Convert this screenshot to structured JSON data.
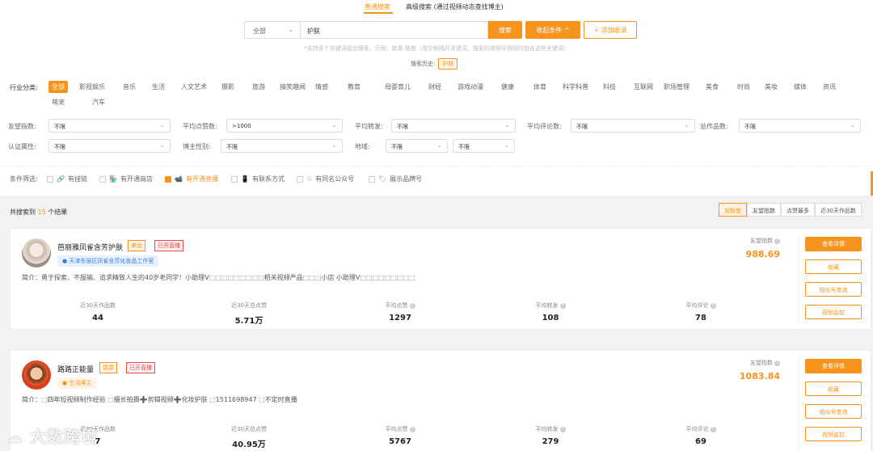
{
  "tabs": {
    "normal": "普通搜索",
    "advanced": "高级搜索 (通过视频动态查找博主)"
  },
  "search": {
    "scope": "全部",
    "query": "护肤",
    "search_btn": "搜索",
    "cond_btn": "收起条件",
    "fav_btn": "添加收录",
    "hint": "*支持多个关键词组合搜索，示例：故事 歌曲（用空格隔开关键词，搜索的视频中将同时包含这些关键词）",
    "history_label": "搜索历史:",
    "history_item": "护肤"
  },
  "industry": {
    "label": "行业分类:",
    "items": [
      "全部",
      "影视娱乐",
      "音乐",
      "生活",
      "人文艺术",
      "摄影",
      "旅游",
      "搞笑趣闻",
      "情感",
      "教育",
      "母婴育儿",
      "财经",
      "游戏动漫",
      "健康",
      "体育",
      "科学科普",
      "科技",
      "互联网",
      "职场管理",
      "美食",
      "时尚",
      "美妆",
      "媒体",
      "资讯",
      "萌宠",
      "汽车"
    ]
  },
  "filters": {
    "r1": [
      {
        "label": "友望指数:",
        "value": "不限"
      },
      {
        "label": "平均点赞数:",
        "value": ">1000"
      },
      {
        "label": "平均转发:",
        "value": "不限"
      },
      {
        "label": "平均评论数:",
        "value": "不限"
      },
      {
        "label": "总作品数:",
        "value": "不限"
      }
    ],
    "r2": [
      {
        "label": "认证属性:",
        "value": "不限"
      },
      {
        "label": "博主性别:",
        "value": "不限"
      },
      {
        "label": "地域:",
        "value": "不限",
        "value2": "不限"
      }
    ]
  },
  "conditions": {
    "label": "条件筛选:",
    "items": [
      "有挂链",
      "有开通商店",
      "有开通直播",
      "有联系方式",
      "有同名公众号",
      "展示品牌号"
    ]
  },
  "results": {
    "prefix": "共搜索到",
    "count": "15",
    "suffix": "个结果"
  },
  "sorts": [
    "友粉度",
    "友望指数",
    "点赞最多",
    "近30天作品数"
  ],
  "cards": [
    {
      "name": "芭丽雅凤雀含芳护肤",
      "tag": "美妆",
      "live": "已开直播",
      "badge": "天津东丽区凤雀含芳化妆品工作室",
      "intro": "简介：勇于探索、不服输、追求精致人生的40岁老同学！小助理V⬚⬚⬚⬚⬚⬚⬚⬚⬚相关视频产品⬚⬚⬚小店 小助理V⬚⬚⬚⬚⬚⬚⬚⬚⬚",
      "stats": [
        {
          "l": "近30天作品数",
          "v": "44"
        },
        {
          "l": "近30天总点赞",
          "v": "5.71万"
        },
        {
          "l": "平均点赞",
          "v": "1297"
        },
        {
          "l": "平均转发",
          "v": "108"
        },
        {
          "l": "平均评论",
          "v": "78"
        }
      ],
      "score_label": "友望指数",
      "score": "988.69",
      "buttons": [
        "查看详情",
        "收藏",
        "相似号查询",
        "视频监控"
      ]
    },
    {
      "name": "路路正能量",
      "tag": "情感",
      "live": "已开直播",
      "badge": "生活博主",
      "intro": "简介：⬚四年短视频制作经验 ⬚擅长拍摄➕剪辑视频➕化妆护肤 ⬚1511698947 ⬚不定时直播",
      "stats": [
        {
          "l": "近30天作品数",
          "v": "7"
        },
        {
          "l": "近30天总点赞",
          "v": "40.95万"
        },
        {
          "l": "平均点赞",
          "v": "5767"
        },
        {
          "l": "平均转发",
          "v": "279"
        },
        {
          "l": "平均评论",
          "v": "69"
        }
      ],
      "score_label": "友望指数",
      "score": "1083.84",
      "buttons": [
        "查看详情",
        "收藏",
        "相似号查询",
        "视频监控"
      ]
    }
  ],
  "watermark": "大数跨境",
  "colors": {
    "accent": "#f7941d",
    "live": "#e64a4a",
    "verified": "#3c7ddc"
  }
}
